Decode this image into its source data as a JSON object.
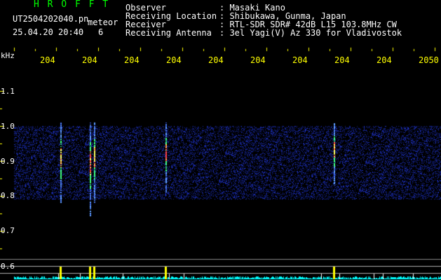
{
  "header": {
    "logo": "H R O F F T",
    "file_name": "UT2504202040.pn",
    "meteor_label": "meteor",
    "date_time": "25.04.20 20:40",
    "count": "6",
    "info": [
      {
        "label": "Observer",
        "value": ": Masaki Kano"
      },
      {
        "label": "Receiving Location",
        "value": ": Shibukawa, Gunma, Japan"
      },
      {
        "label": "Receiver",
        "value": ": RTL-SDR SDR# 42dB L15 103.8MHz CW"
      },
      {
        "label": "Receiving Antenna",
        "value": ": 3el Yagi(V) Az 330 for Vladivostok"
      }
    ]
  },
  "axis": {
    "unit": "kHz",
    "y_ticks": [
      "1.1",
      "1.0",
      "0.9",
      "0.8",
      "0.7",
      "0.6"
    ],
    "x_ticks": [
      "204",
      "204",
      "204",
      "204",
      "204",
      "204",
      "204",
      "204",
      "204",
      "2050"
    ]
  },
  "chart_data": {
    "type": "heatmap",
    "ylabel": "kHz",
    "ylim": [
      0.6,
      1.1
    ],
    "meteor_echoes_minutes": [
      1.1,
      1.8,
      1.9,
      3.6,
      7.6
    ]
  },
  "colors": {
    "background": "#000000",
    "info_text": "#ffffff",
    "ticks": "#ffff00",
    "logo": "#00ff00",
    "noise": "#1a2a9a",
    "spectrum": "#00ffff"
  }
}
